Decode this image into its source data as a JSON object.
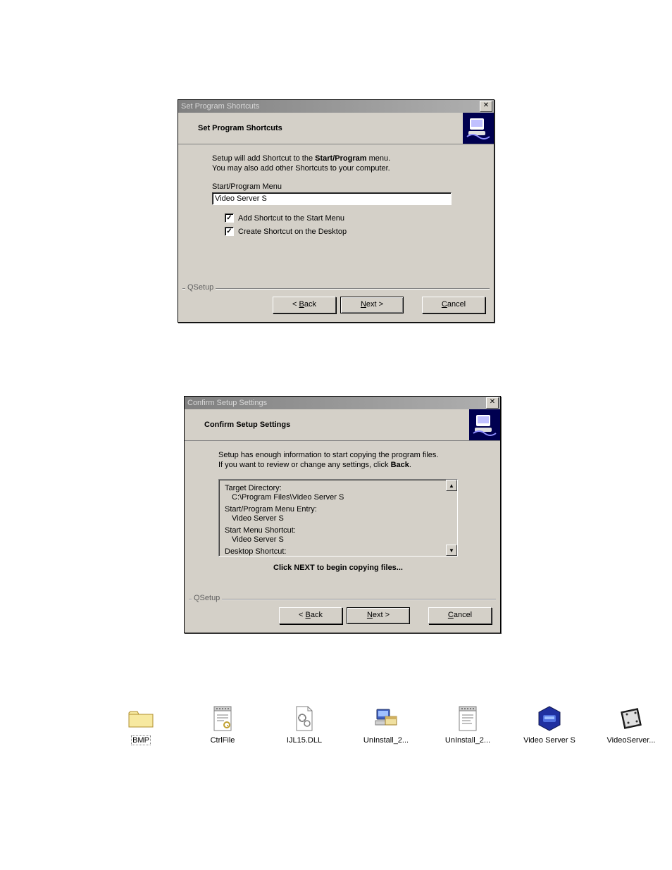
{
  "dialog1": {
    "title": "Set Program Shortcuts",
    "header": "Set Program Shortcuts",
    "instr1_a": "Setup will add Shortcut to the ",
    "instr1_bold": "Start/Program",
    "instr1_b": " menu.",
    "instr2": "You may also add other Shortcuts to your computer.",
    "menu_label": "Start/Program Menu",
    "menu_value": "Video Server S",
    "check1": "Add Shortcut to the Start Menu",
    "check2": "Create Shortcut on the Desktop",
    "group": "QSetup",
    "back": "< Back",
    "next": "Next >",
    "cancel": "Cancel"
  },
  "dialog2": {
    "title": "Confirm Setup Settings",
    "header": "Confirm Setup Settings",
    "instr1": "Setup has enough information to start copying the program files.",
    "instr2_a": "If you want to review or change any settings, click ",
    "instr2_bold": "Back",
    "instr2_b": ".",
    "l1": "Target Directory:",
    "l1v": "C:\\Program Files\\Video Server S",
    "l2": "Start/Program Menu Entry:",
    "l2v": "Video Server S",
    "l3": "Start Menu Shortcut:",
    "l3v": "Video Server S",
    "l4": "Desktop Shortcut:",
    "confirm": "Click NEXT to begin copying files...",
    "group": "QSetup",
    "back": "< Back",
    "next": "Next >",
    "cancel": "Cancel"
  },
  "icons": {
    "i1": "BMP",
    "i2": "CtrlFile",
    "i3": "IJL15.DLL",
    "i4": "UnInstall_2...",
    "i5": "UnInstall_2...",
    "i6": "Video Server S",
    "i7": "VideoServer..."
  }
}
